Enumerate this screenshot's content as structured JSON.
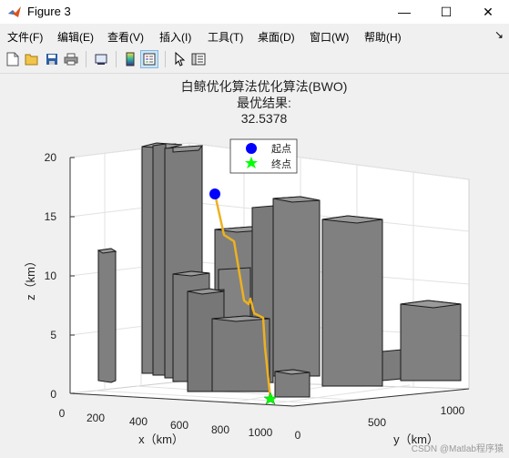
{
  "window": {
    "title": "Figure 3"
  },
  "window_controls": {
    "minimize": "—",
    "maximize": "☐",
    "close": "✕"
  },
  "menu": [
    "文件(F)",
    "编辑(E)",
    "查看(V)",
    "插入(I)",
    "工具(T)",
    "桌面(D)",
    "窗口(W)",
    "帮助(H)"
  ],
  "menu_extra": "↘",
  "toolbar_icons": [
    "new-figure-icon",
    "open-file-icon",
    "save-icon",
    "print-icon",
    "print-preview-icon",
    "colorbar-icon",
    "legend-icon",
    "pointer-icon",
    "property-editor-icon"
  ],
  "plot": {
    "title_line1": "白鲸优化算法优化算法(BWO)",
    "title_line2": "最优结果:",
    "title_line3": "32.5378",
    "xlabel": "x（km）",
    "ylabel": "y（km）",
    "zlabel": "z（km）",
    "xticks": [
      "0",
      "200",
      "400",
      "600",
      "800",
      "1000"
    ],
    "yticks": [
      "0",
      "500",
      "1000"
    ],
    "zticks": [
      "0",
      "5",
      "10",
      "15",
      "20"
    ],
    "legend": [
      {
        "label": "起点",
        "marker": "circle",
        "color": "#0000ff"
      },
      {
        "label": "终点",
        "marker": "star",
        "color": "#00ff00"
      }
    ],
    "path_color": "#edb120",
    "building_color": "#808080"
  },
  "watermark": "CSDN @Matlab程序猿"
}
